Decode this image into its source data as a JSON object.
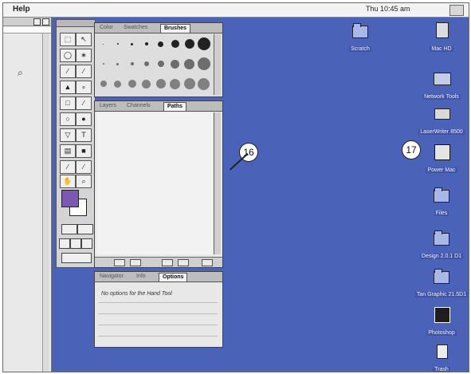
{
  "menubar": {
    "help_menu": "Help",
    "clock": "Thu 10:45 am"
  },
  "tool_palette": {
    "tools": [
      "marquee-icon",
      "move-icon",
      "lasso-icon",
      "magic-wand-icon",
      "airbrush-icon",
      "paintbrush-icon",
      "stamp-icon",
      "smudge-icon",
      "eraser-icon",
      "pencil-icon",
      "blur-icon",
      "dodge-icon",
      "pen-icon",
      "type-icon",
      "gradient-icon",
      "paint-bucket-icon",
      "eyedropper-icon",
      "line-icon",
      "hand-icon",
      "zoom-icon"
    ]
  },
  "brushes_palette": {
    "tabs": [
      "Color",
      "Swatches",
      "Brushes"
    ],
    "active_tab": "Brushes"
  },
  "paths_palette": {
    "tabs": [
      "Layers",
      "Channels",
      "Paths"
    ],
    "active_tab": "Paths"
  },
  "options_palette": {
    "tabs": [
      "Navigator",
      "Info",
      "Options"
    ],
    "active_tab": "Options",
    "hint": "No options for the Hand Tool"
  },
  "callouts": [
    "16",
    "17"
  ],
  "desktop_icons": [
    {
      "label": "Scratch",
      "kind": "folder"
    },
    {
      "label": "Mac HD",
      "kind": "drive"
    },
    {
      "label": "Network Tools",
      "kind": "server"
    },
    {
      "label": "LaserWriter 8500",
      "kind": "printer"
    },
    {
      "label": "Power Mac",
      "kind": "disk"
    },
    {
      "label": "Files",
      "kind": "folder"
    },
    {
      "label": "Design 2.0.1 D1",
      "kind": "folder"
    },
    {
      "label": "Tan Graphic 21.5D1",
      "kind": "folder"
    },
    {
      "label": "Photoshop",
      "kind": "app"
    },
    {
      "label": "Trash",
      "kind": "trash"
    }
  ]
}
